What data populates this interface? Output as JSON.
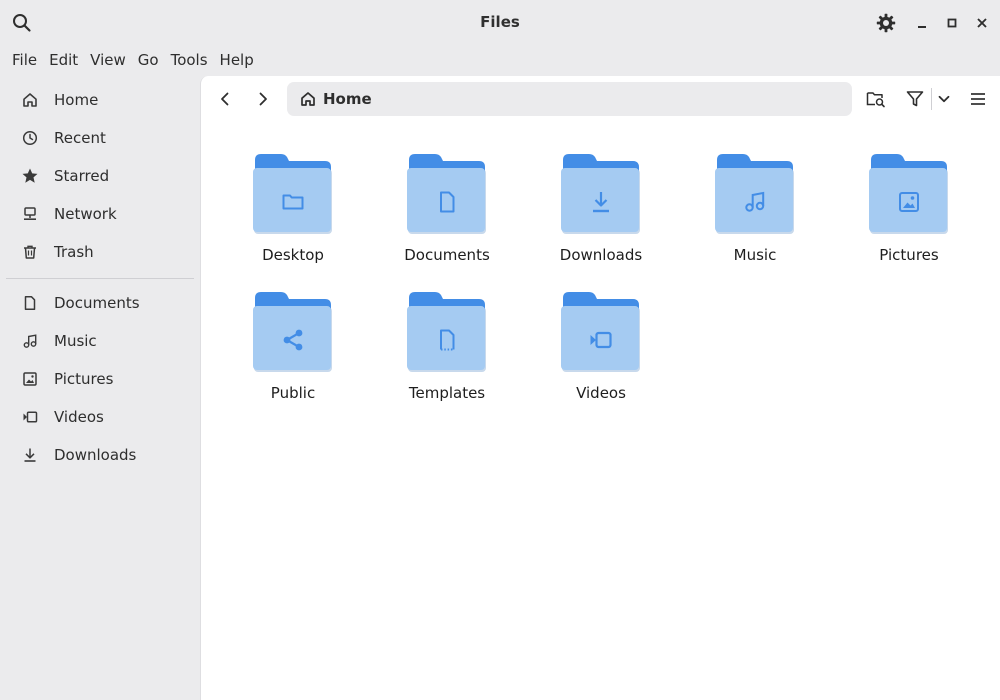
{
  "window": {
    "title": "Files"
  },
  "menu": [
    "File",
    "Edit",
    "View",
    "Go",
    "Tools",
    "Help"
  ],
  "sidebar": {
    "places": [
      {
        "label": "Home",
        "icon": "home-icon"
      },
      {
        "label": "Recent",
        "icon": "clock-icon"
      },
      {
        "label": "Starred",
        "icon": "star-icon"
      },
      {
        "label": "Network",
        "icon": "network-icon"
      },
      {
        "label": "Trash",
        "icon": "trash-icon"
      }
    ],
    "bookmarks": [
      {
        "label": "Documents",
        "icon": "document-icon"
      },
      {
        "label": "Music",
        "icon": "music-icon"
      },
      {
        "label": "Pictures",
        "icon": "picture-icon"
      },
      {
        "label": "Videos",
        "icon": "video-icon"
      },
      {
        "label": "Downloads",
        "icon": "download-icon"
      }
    ]
  },
  "pathbar": {
    "label": "Home"
  },
  "folders": [
    {
      "label": "Desktop",
      "glyph": "folder-glyph"
    },
    {
      "label": "Documents",
      "glyph": "document-glyph"
    },
    {
      "label": "Downloads",
      "glyph": "download-glyph"
    },
    {
      "label": "Music",
      "glyph": "music-glyph"
    },
    {
      "label": "Pictures",
      "glyph": "picture-glyph"
    },
    {
      "label": "Public",
      "glyph": "share-glyph"
    },
    {
      "label": "Templates",
      "glyph": "template-glyph"
    },
    {
      "label": "Videos",
      "glyph": "video-glyph"
    }
  ],
  "colors": {
    "folder_back": "#438de6",
    "folder_front": "#a5cbf2",
    "folder_glyph": "#438de6",
    "icon": "#3a3a3a"
  }
}
